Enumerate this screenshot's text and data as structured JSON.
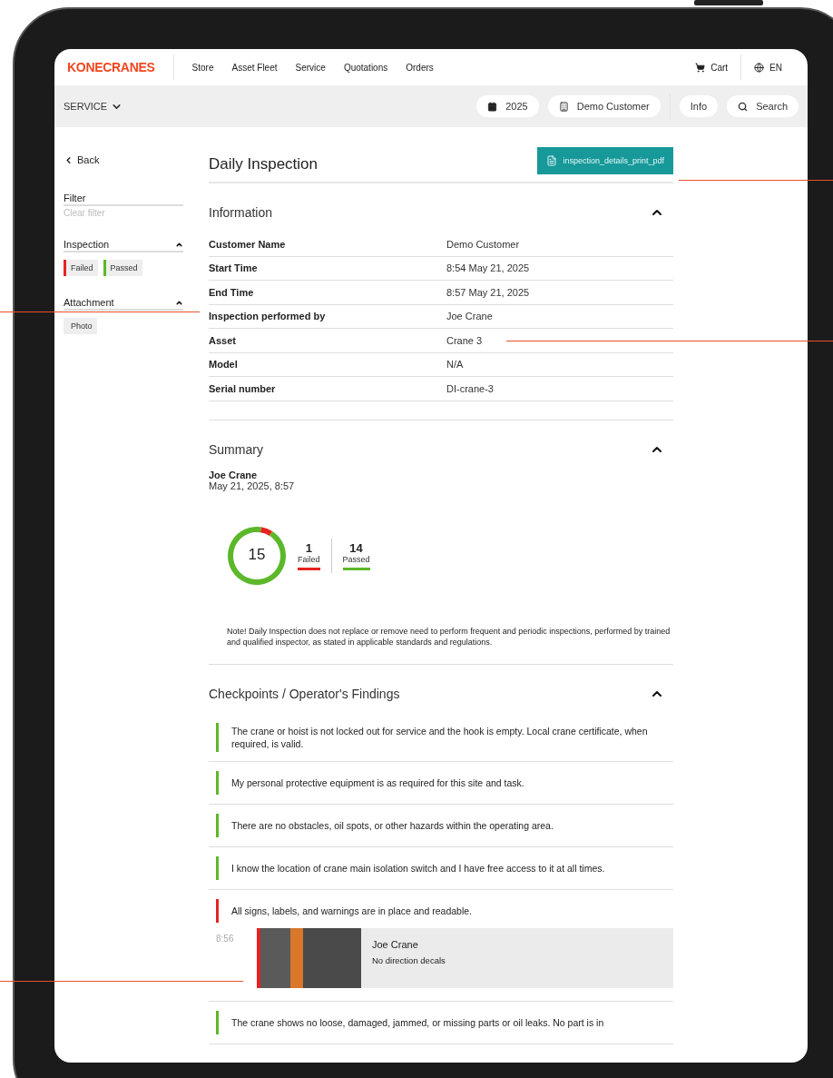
{
  "header": {
    "logo": "KONECRANES",
    "menu": [
      {
        "label": "Store"
      },
      {
        "label": "Asset Fleet"
      },
      {
        "label": "Service"
      },
      {
        "label": "Quotations"
      },
      {
        "label": "Orders"
      }
    ],
    "cart": "Cart",
    "language": "EN"
  },
  "subbar": {
    "section": "SERVICE",
    "year": "2025",
    "customer": "Demo Customer",
    "info": "Info",
    "search": "Search"
  },
  "sidebar": {
    "back": "Back",
    "filter": "Filter",
    "clear_filter": "Clear filter",
    "groups": [
      {
        "title": "Inspection",
        "expanded": true,
        "tags": [
          {
            "label": "Failed",
            "color": "#e52420"
          },
          {
            "label": "Passed",
            "color": "#5cb82a"
          }
        ]
      },
      {
        "title": "Attachment",
        "expanded": true,
        "tags": [
          {
            "label": "Photo"
          }
        ]
      }
    ]
  },
  "page": {
    "title": "Daily Inspection",
    "pdf_button": "inspection_details_print_pdf"
  },
  "information": {
    "title": "Information",
    "expanded": true,
    "rows": [
      {
        "label": "Customer Name",
        "value": "Demo Customer"
      },
      {
        "label": "Start Time",
        "value": "8:54 May 21, 2025"
      },
      {
        "label": "End Time",
        "value": "8:57 May 21, 2025"
      },
      {
        "label": "Inspection performed by",
        "value": "Joe Crane"
      },
      {
        "label": "Asset",
        "value": "Crane 3"
      },
      {
        "label": "Model",
        "value": "N/A"
      },
      {
        "label": "Serial number",
        "value": "DI-crane-3"
      }
    ]
  },
  "summary": {
    "title": "Summary",
    "expanded": true,
    "inspector": "Joe Crane",
    "date": "May 21, 2025, 8:57",
    "total": "15",
    "stats": [
      {
        "value": "1",
        "label": "Failed",
        "color": "#e52420"
      },
      {
        "value": "14",
        "label": "Passed",
        "color": "#5cb82a"
      }
    ],
    "note": "Note! Daily Inspection does not replace or remove need to perform frequent and periodic inspections, performed by trained and qualified inspector, as stated in applicable standards and regulations."
  },
  "checkpoints": {
    "title": "Checkpoints / Operator's Findings",
    "expanded": true,
    "items": [
      {
        "text": "The crane or hoist is not locked out for service and the hook is empty. Local crane certificate, when required, is valid.",
        "color": "#5cb82a"
      },
      {
        "text": "My personal protective equipment is as required for this site and task.",
        "color": "#5cb82a"
      },
      {
        "text": "There are no obstacles, oil spots, or other hazards within the operating area.",
        "color": "#5cb82a"
      },
      {
        "text": "I know the location of crane main isolation switch and I have free access to it at all times.",
        "color": "#5cb82a"
      },
      {
        "text": "All signs, labels, and warnings are in place and readable.",
        "color": "#e52420",
        "finding": {
          "time": "8:56",
          "author": "Joe Crane",
          "note": "No direction decals"
        }
      },
      {
        "text": "The crane shows no loose, damaged, jammed, or missing parts or oil leaks. No part is in",
        "color": "#5cb82a"
      }
    ]
  }
}
